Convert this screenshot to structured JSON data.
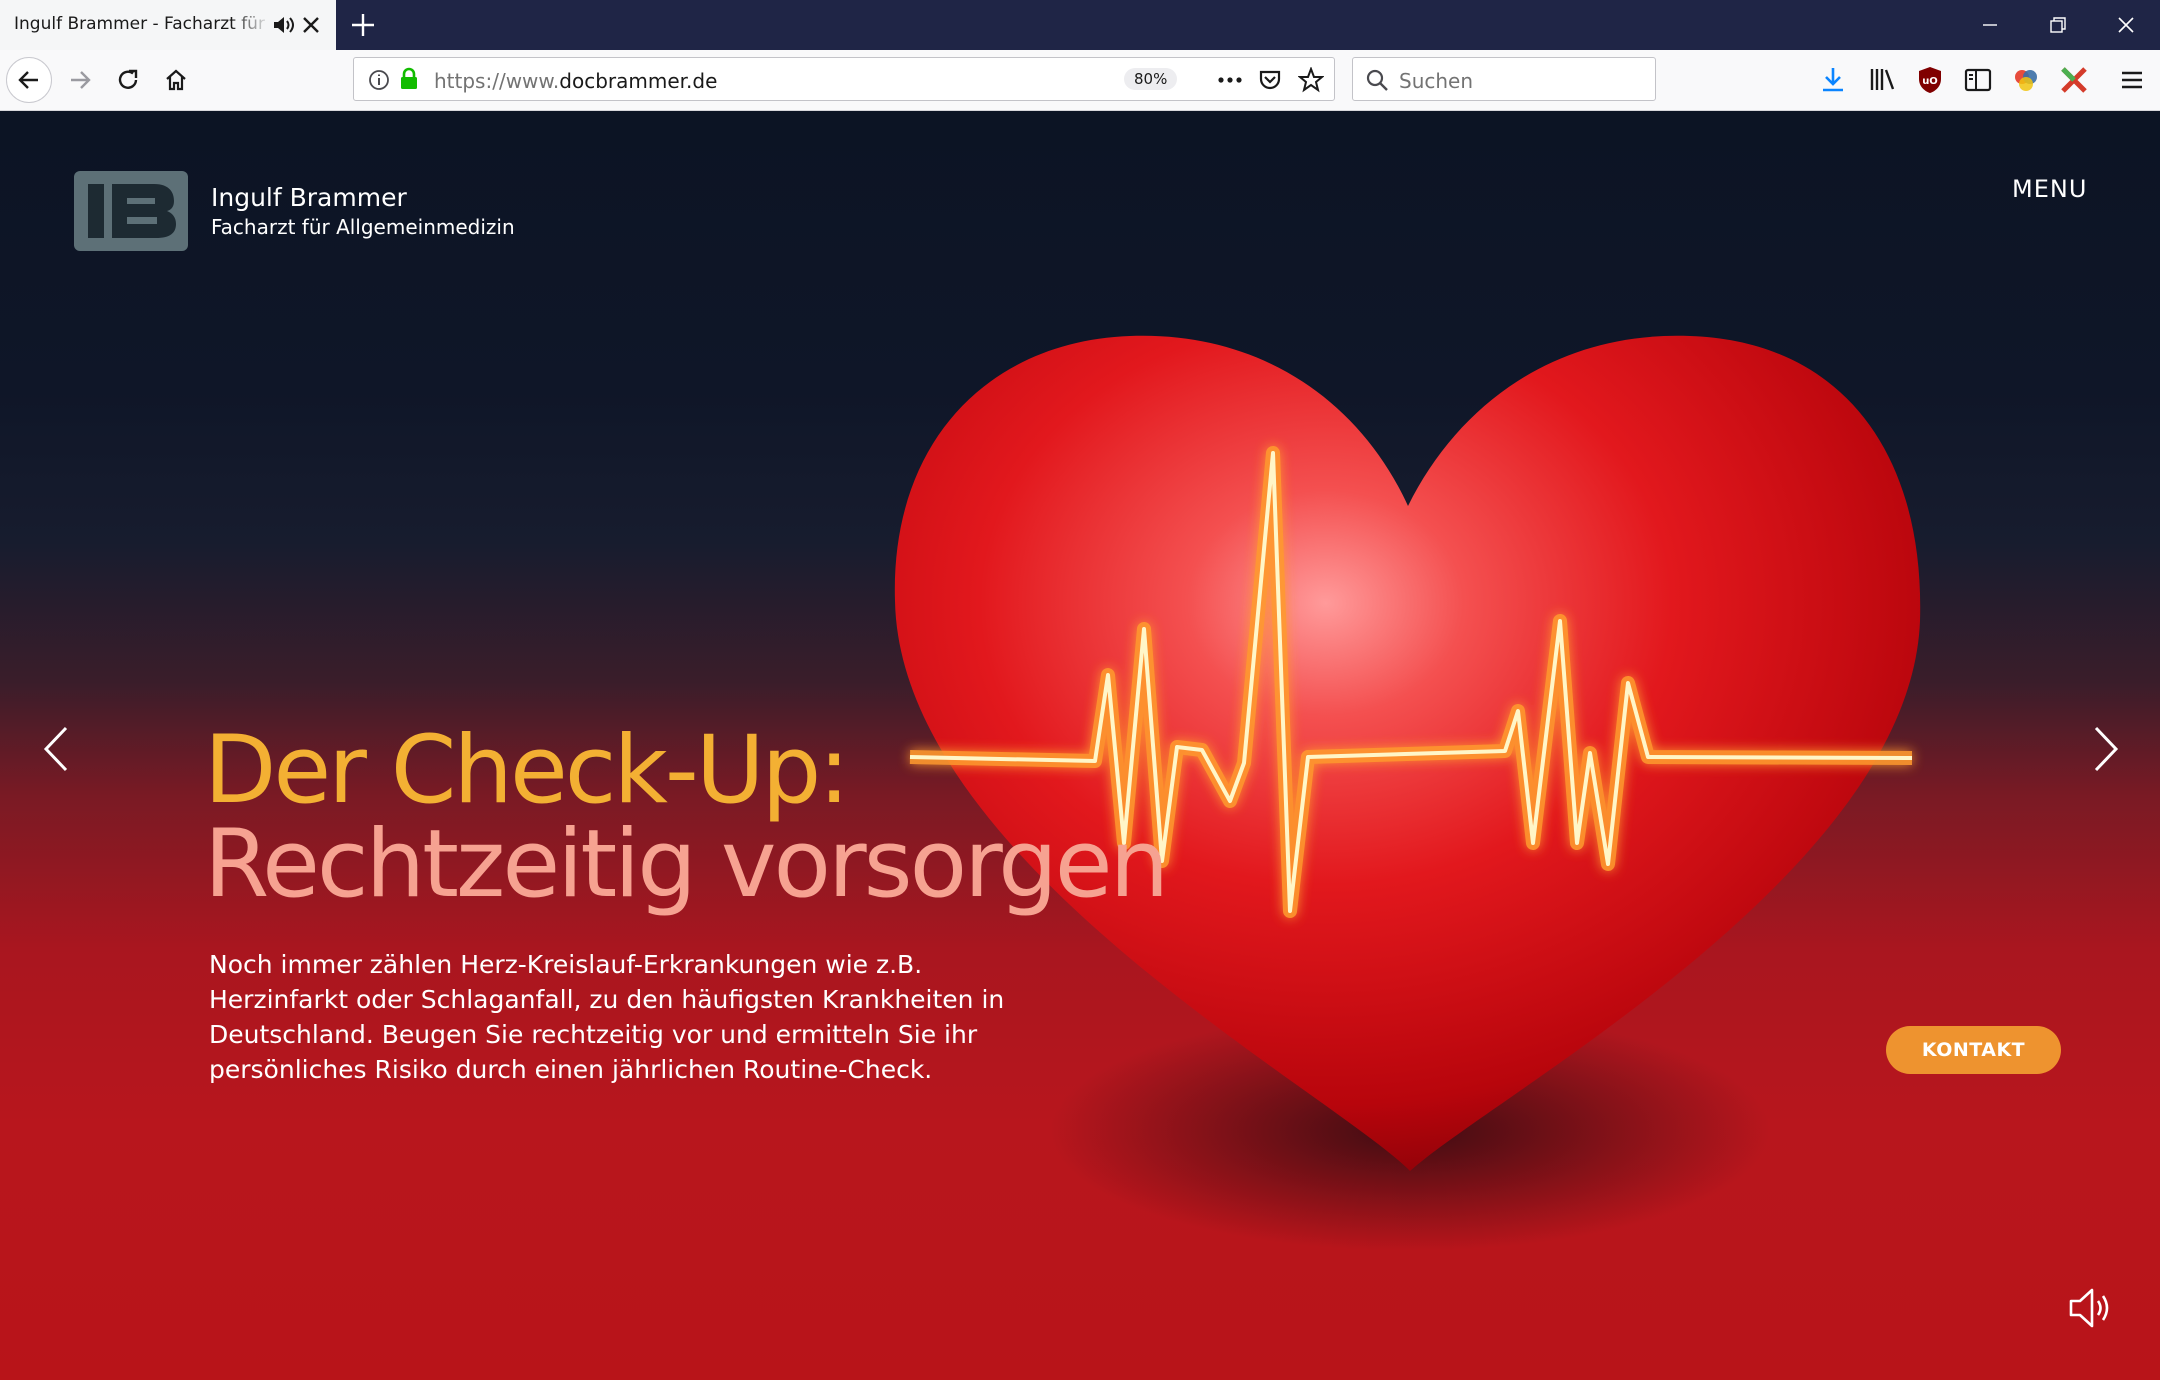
{
  "browser": {
    "tab_title": "Ingulf Brammer - Facharzt für Allgemeinmedizin",
    "url_prefix": "https://www.",
    "url_domain": "docbrammer.de",
    "zoom": "80%",
    "search_placeholder": "Suchen"
  },
  "site": {
    "logo_text": "IB",
    "brand_name": "Ingulf Brammer",
    "brand_subtitle": "Facharzt für Allgemeinmedizin",
    "menu_label": "MENU"
  },
  "hero": {
    "headline_line1": "Der Check-Up:",
    "headline_line2": "Rechtzeitig vorsorgen",
    "body": "Noch immer zählen Herz-Kreislauf-Erkrankungen wie z.B. Herzinfarkt oder Schlaganfall, zu den häufigsten Krankheiten in Deutschland. Beugen Sie rechtzeitig vor und ermitteln Sie ihr persönliches Risiko durch einen jährlichen Routine-Check.",
    "cta_label": "KONTAKT"
  },
  "colors": {
    "headline_primary": "#f3b033",
    "headline_secondary": "#f6a291",
    "cta": "#ee932f",
    "logo": "#5d7077"
  }
}
